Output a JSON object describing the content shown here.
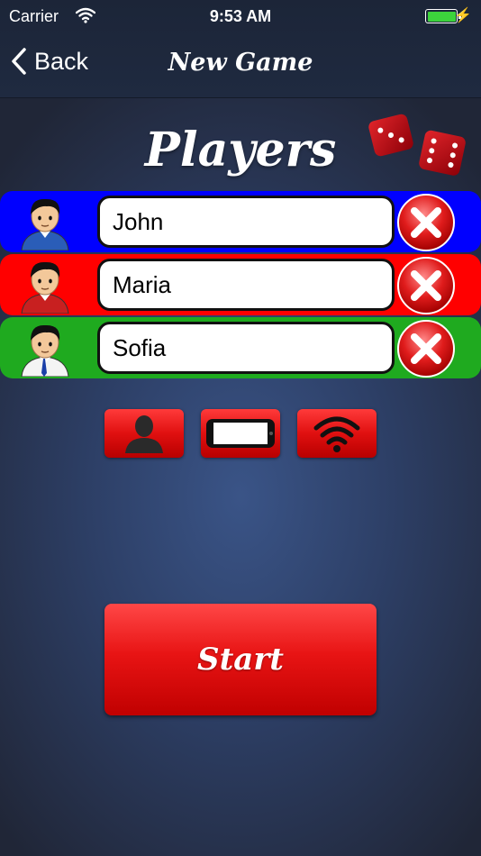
{
  "status_bar": {
    "carrier": "Carrier",
    "time": "9:53 AM"
  },
  "nav": {
    "back_label": "Back",
    "title": "New Game"
  },
  "heading": "Players",
  "players": [
    {
      "name": "John",
      "color": "#0000ff"
    },
    {
      "name": "Maria",
      "color": "#ff0000"
    },
    {
      "name": "Sofia",
      "color": "#1faa1f"
    }
  ],
  "mode_buttons": [
    "person-icon",
    "phone-icon",
    "wifi-icon"
  ],
  "start_label": "Start",
  "colors": {
    "accent_red": "#e01010",
    "nav_bg": "#1c2538"
  }
}
